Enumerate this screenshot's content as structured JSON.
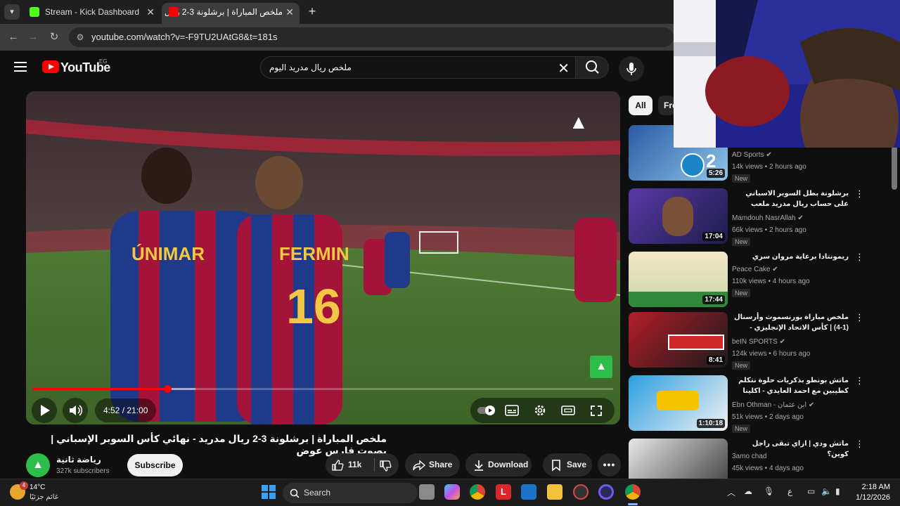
{
  "browser": {
    "tabs": [
      {
        "title": "Stream - Kick Dashboard",
        "favicon_color": "#53fc18"
      },
      {
        "title": "ملخص المباراة | برشلونة 3-2 ريال",
        "favicon_color": "#ff0000"
      }
    ],
    "url": "youtube.com/watch?v=-F9TU2UAtG8&t=181s"
  },
  "youtube": {
    "logo_text": "YouTube",
    "country_code": "EG",
    "search_query": "ملخص ريال مدريد اليوم"
  },
  "player": {
    "current_time": "4:52",
    "duration": "21:00",
    "time_display": "4:52 / 21:00",
    "progress_fraction": 0.232,
    "buffered_fraction": 0.28
  },
  "video": {
    "title": "ملخص المباراة | برشلونة 3-2 ريال مدريد - نهائي كأس السوبر الإسباني | بصوت فارس عوض",
    "channel_name": "رياضة ثانية",
    "subscribers": "327k subscribers",
    "subscribe_label": "Subscribe",
    "likes": "11k",
    "share_label": "Share",
    "download_label": "Download",
    "save_label": "Save"
  },
  "sidebar": {
    "chips": [
      "All",
      "Fro"
    ],
    "recommendations": [
      {
        "title": "",
        "channel": "AD Sports",
        "verified": true,
        "meta": "14k views • 2 hours ago",
        "badge": "New",
        "duration": "5:26"
      },
      {
        "title": "برشلونة بطل السوبر الاسباني على حساب ريال مدريد ملعب الإنماء يشهد الكلاسيكو ...",
        "channel": "Mamdouh NasrAllah",
        "verified": true,
        "meta": "66k views • 2 hours ago",
        "badge": "New",
        "duration": "17:04"
      },
      {
        "title": "ريمونتادا برعاية مروان سري",
        "channel": "Peace Cake",
        "verified": true,
        "meta": "110k views • 4 hours ago",
        "badge": "New",
        "duration": "17:44"
      },
      {
        "title": "ملخص مباراة بورنسموث وأرسنال (1-4) | كأس الاتحاد الإنجليزي - الدور الثالث",
        "channel": "beIN SPORTS",
        "verified": true,
        "meta": "124k views • 6 hours ago",
        "badge": "New",
        "duration": "8:41"
      },
      {
        "title": "ماتش بونطو بذكريات حلوة نتكلم كطيبين مع احمد العايدي - اكلينا شر الاهيل",
        "channel": "Ebn Othman - ابن عثمان",
        "verified": true,
        "meta": "51k views • 2 days ago",
        "badge": "New",
        "duration": "1:10:18"
      },
      {
        "title": "ماتش ودي | ازاي تبقى راجل كوين؟",
        "channel": "3amo chad",
        "verified": false,
        "meta": "45k views • 4 days ago",
        "badge": "",
        "duration": ""
      }
    ]
  },
  "taskbar": {
    "temperature": "14°C",
    "weather_desc": "غائم جزئيًا",
    "weather_badge": "4",
    "search_label": "Search",
    "time": "2:18 AM",
    "date": "1/12/2026",
    "lang": "ع"
  }
}
